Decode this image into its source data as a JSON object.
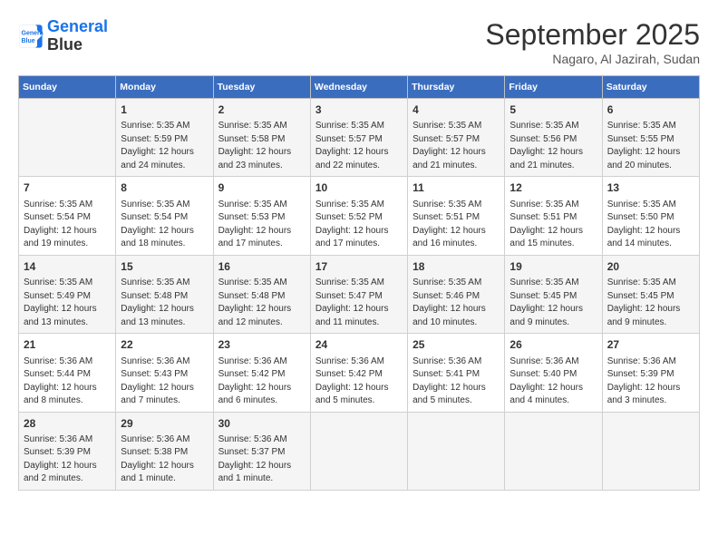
{
  "logo": {
    "line1": "General",
    "line2": "Blue"
  },
  "title": "September 2025",
  "location": "Nagaro, Al Jazirah, Sudan",
  "weekdays": [
    "Sunday",
    "Monday",
    "Tuesday",
    "Wednesday",
    "Thursday",
    "Friday",
    "Saturday"
  ],
  "weeks": [
    [
      {
        "day": "",
        "info": ""
      },
      {
        "day": "1",
        "info": "Sunrise: 5:35 AM\nSunset: 5:59 PM\nDaylight: 12 hours\nand 24 minutes."
      },
      {
        "day": "2",
        "info": "Sunrise: 5:35 AM\nSunset: 5:58 PM\nDaylight: 12 hours\nand 23 minutes."
      },
      {
        "day": "3",
        "info": "Sunrise: 5:35 AM\nSunset: 5:57 PM\nDaylight: 12 hours\nand 22 minutes."
      },
      {
        "day": "4",
        "info": "Sunrise: 5:35 AM\nSunset: 5:57 PM\nDaylight: 12 hours\nand 21 minutes."
      },
      {
        "day": "5",
        "info": "Sunrise: 5:35 AM\nSunset: 5:56 PM\nDaylight: 12 hours\nand 21 minutes."
      },
      {
        "day": "6",
        "info": "Sunrise: 5:35 AM\nSunset: 5:55 PM\nDaylight: 12 hours\nand 20 minutes."
      }
    ],
    [
      {
        "day": "7",
        "info": "Sunrise: 5:35 AM\nSunset: 5:54 PM\nDaylight: 12 hours\nand 19 minutes."
      },
      {
        "day": "8",
        "info": "Sunrise: 5:35 AM\nSunset: 5:54 PM\nDaylight: 12 hours\nand 18 minutes."
      },
      {
        "day": "9",
        "info": "Sunrise: 5:35 AM\nSunset: 5:53 PM\nDaylight: 12 hours\nand 17 minutes."
      },
      {
        "day": "10",
        "info": "Sunrise: 5:35 AM\nSunset: 5:52 PM\nDaylight: 12 hours\nand 17 minutes."
      },
      {
        "day": "11",
        "info": "Sunrise: 5:35 AM\nSunset: 5:51 PM\nDaylight: 12 hours\nand 16 minutes."
      },
      {
        "day": "12",
        "info": "Sunrise: 5:35 AM\nSunset: 5:51 PM\nDaylight: 12 hours\nand 15 minutes."
      },
      {
        "day": "13",
        "info": "Sunrise: 5:35 AM\nSunset: 5:50 PM\nDaylight: 12 hours\nand 14 minutes."
      }
    ],
    [
      {
        "day": "14",
        "info": "Sunrise: 5:35 AM\nSunset: 5:49 PM\nDaylight: 12 hours\nand 13 minutes."
      },
      {
        "day": "15",
        "info": "Sunrise: 5:35 AM\nSunset: 5:48 PM\nDaylight: 12 hours\nand 13 minutes."
      },
      {
        "day": "16",
        "info": "Sunrise: 5:35 AM\nSunset: 5:48 PM\nDaylight: 12 hours\nand 12 minutes."
      },
      {
        "day": "17",
        "info": "Sunrise: 5:35 AM\nSunset: 5:47 PM\nDaylight: 12 hours\nand 11 minutes."
      },
      {
        "day": "18",
        "info": "Sunrise: 5:35 AM\nSunset: 5:46 PM\nDaylight: 12 hours\nand 10 minutes."
      },
      {
        "day": "19",
        "info": "Sunrise: 5:35 AM\nSunset: 5:45 PM\nDaylight: 12 hours\nand 9 minutes."
      },
      {
        "day": "20",
        "info": "Sunrise: 5:35 AM\nSunset: 5:45 PM\nDaylight: 12 hours\nand 9 minutes."
      }
    ],
    [
      {
        "day": "21",
        "info": "Sunrise: 5:36 AM\nSunset: 5:44 PM\nDaylight: 12 hours\nand 8 minutes."
      },
      {
        "day": "22",
        "info": "Sunrise: 5:36 AM\nSunset: 5:43 PM\nDaylight: 12 hours\nand 7 minutes."
      },
      {
        "day": "23",
        "info": "Sunrise: 5:36 AM\nSunset: 5:42 PM\nDaylight: 12 hours\nand 6 minutes."
      },
      {
        "day": "24",
        "info": "Sunrise: 5:36 AM\nSunset: 5:42 PM\nDaylight: 12 hours\nand 5 minutes."
      },
      {
        "day": "25",
        "info": "Sunrise: 5:36 AM\nSunset: 5:41 PM\nDaylight: 12 hours\nand 5 minutes."
      },
      {
        "day": "26",
        "info": "Sunrise: 5:36 AM\nSunset: 5:40 PM\nDaylight: 12 hours\nand 4 minutes."
      },
      {
        "day": "27",
        "info": "Sunrise: 5:36 AM\nSunset: 5:39 PM\nDaylight: 12 hours\nand 3 minutes."
      }
    ],
    [
      {
        "day": "28",
        "info": "Sunrise: 5:36 AM\nSunset: 5:39 PM\nDaylight: 12 hours\nand 2 minutes."
      },
      {
        "day": "29",
        "info": "Sunrise: 5:36 AM\nSunset: 5:38 PM\nDaylight: 12 hours\nand 1 minute."
      },
      {
        "day": "30",
        "info": "Sunrise: 5:36 AM\nSunset: 5:37 PM\nDaylight: 12 hours\nand 1 minute."
      },
      {
        "day": "",
        "info": ""
      },
      {
        "day": "",
        "info": ""
      },
      {
        "day": "",
        "info": ""
      },
      {
        "day": "",
        "info": ""
      }
    ]
  ]
}
